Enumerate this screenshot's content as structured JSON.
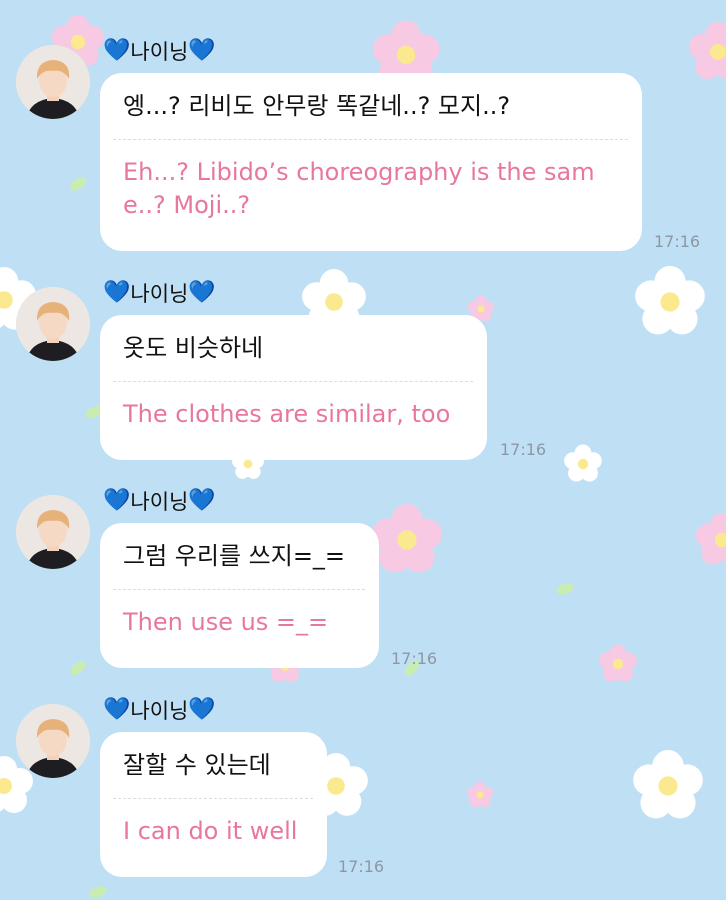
{
  "colors": {
    "background": "#bfdff5",
    "bubble": "#ffffff",
    "translation_text": "#e8779d",
    "timestamp": "#8c98a3",
    "heart": "#1a73e8"
  },
  "messages": [
    {
      "sender": "나이닝",
      "sender_prefix_icon": "blue-heart-icon",
      "sender_suffix_icon": "blue-heart-icon",
      "original": "엥...? 리비도 안무랑 똑같네..? 모지..?",
      "translation": "Eh...? Libido’s choreography is the same..? Moji..?",
      "time": "17:16"
    },
    {
      "sender": "나이닝",
      "sender_prefix_icon": "blue-heart-icon",
      "sender_suffix_icon": "blue-heart-icon",
      "original": "옷도 비슷하네",
      "translation": "The clothes are similar, too",
      "time": "17:16"
    },
    {
      "sender": "나이닝",
      "sender_prefix_icon": "blue-heart-icon",
      "sender_suffix_icon": "blue-heart-icon",
      "original": "그럼 우리를 쓰지=_=",
      "translation": "Then use us =_=",
      "time": "17:16"
    },
    {
      "sender": "나이닝",
      "sender_prefix_icon": "blue-heart-icon",
      "sender_suffix_icon": "blue-heart-icon",
      "original": "잘할 수 있는데",
      "translation": "I can do it well",
      "time": "17:16"
    }
  ]
}
